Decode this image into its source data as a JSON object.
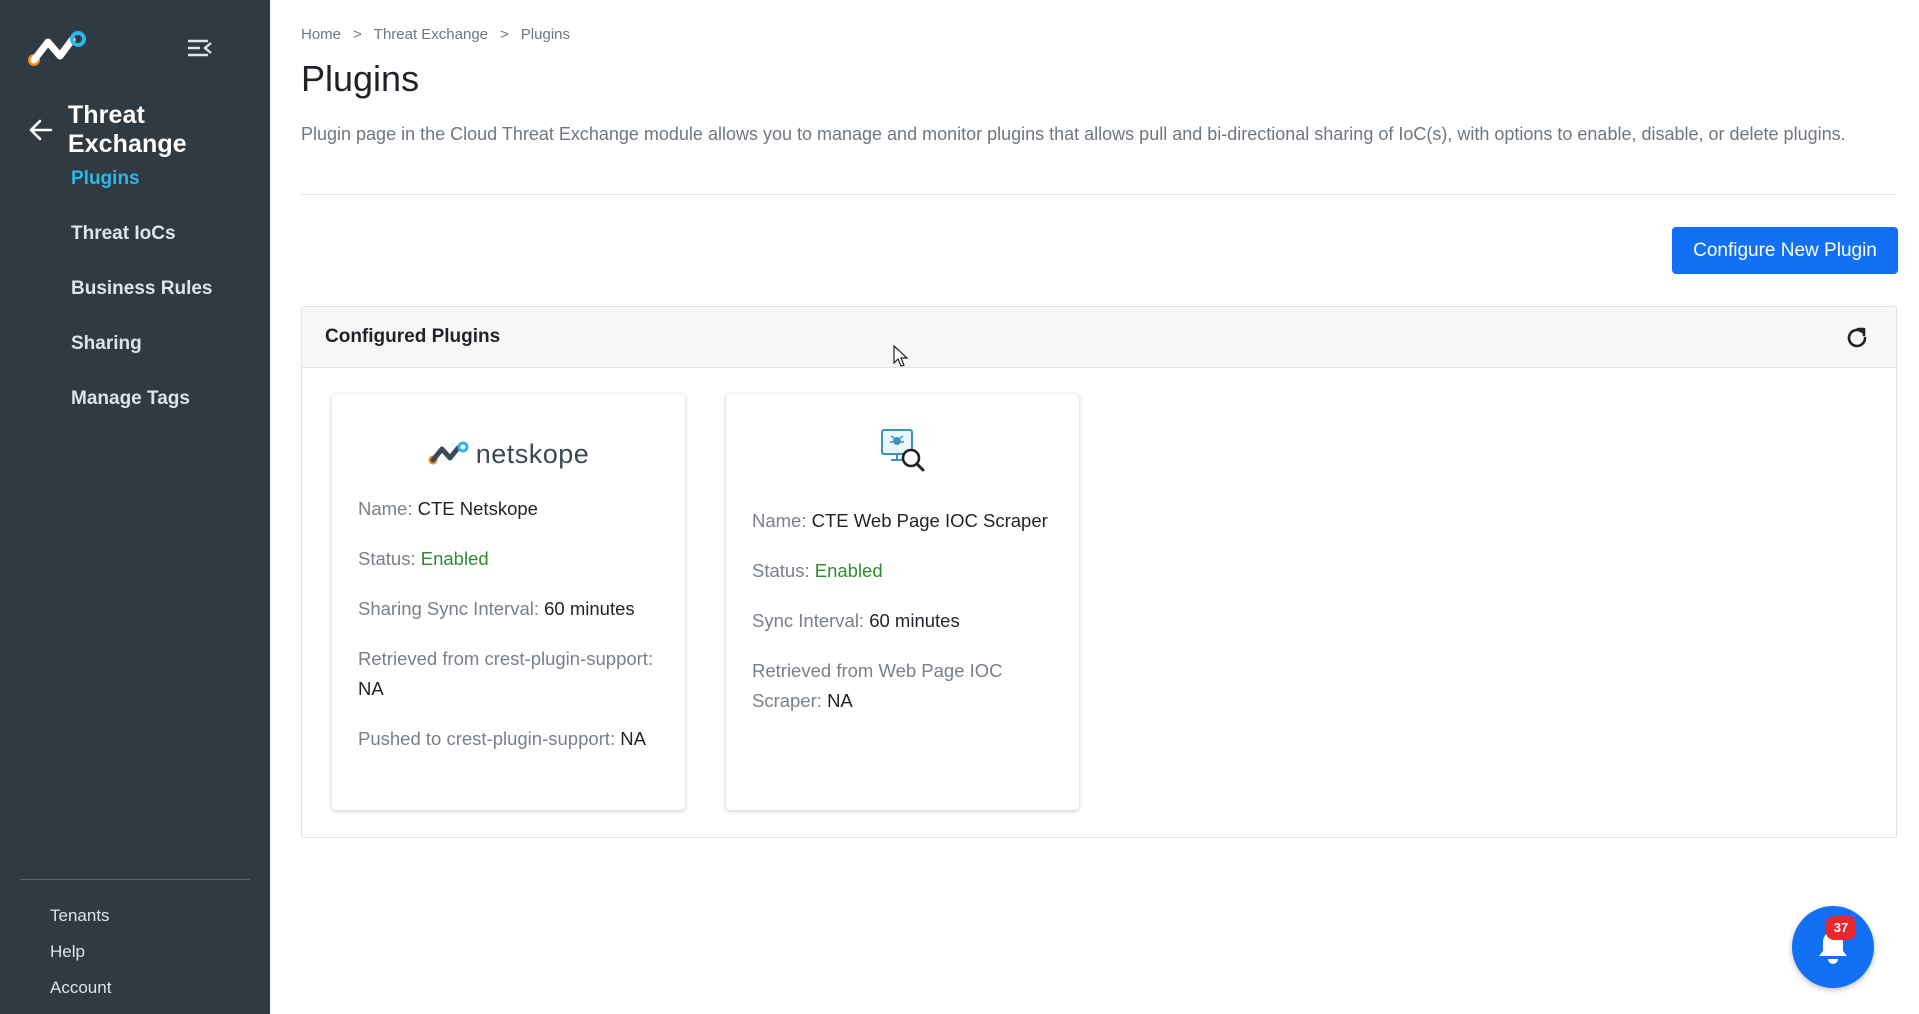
{
  "sidebar": {
    "section_title": "Threat Exchange",
    "items": [
      {
        "label": "Plugins",
        "active": true
      },
      {
        "label": "Threat IoCs"
      },
      {
        "label": "Business Rules"
      },
      {
        "label": "Sharing"
      },
      {
        "label": "Manage Tags"
      }
    ],
    "bottom_items": [
      {
        "label": "Tenants"
      },
      {
        "label": "Help"
      },
      {
        "label": "Account"
      }
    ]
  },
  "breadcrumb": {
    "items": [
      "Home",
      "Threat Exchange",
      "Plugins"
    ],
    "separator": ">"
  },
  "page": {
    "title": "Plugins",
    "description": "Plugin page in the Cloud Threat Exchange module allows you to manage and monitor plugins that allows pull and bi-directional sharing of IoC(s), with options to enable, disable, or delete plugins."
  },
  "toolbar": {
    "configure_label": "Configure New Plugin"
  },
  "panel": {
    "title": "Configured Plugins"
  },
  "plugins": [
    {
      "logo_text": "netskope",
      "name_label": "Name:",
      "name": "CTE Netskope",
      "status_label": "Status:",
      "status": "Enabled",
      "interval_label": "Sharing Sync Interval:",
      "interval": "60 minutes",
      "retrieved_label": "Retrieved from crest-plugin-support:",
      "retrieved": "NA",
      "pushed_label": "Pushed to crest-plugin-support:",
      "pushed": "NA"
    },
    {
      "name_label": "Name:",
      "name": "CTE Web Page IOC Scraper",
      "status_label": "Status:",
      "status": "Enabled",
      "interval_label": "Sync Interval:",
      "interval": "60 minutes",
      "retrieved_label": "Retrieved from Web Page IOC Scraper:",
      "retrieved": "NA"
    }
  ],
  "notifications": {
    "count": "37"
  },
  "colors": {
    "sidebar_bg": "#2f3a42",
    "active_nav": "#2db7e8",
    "primary_button": "#1270f5",
    "enabled_status": "#2e8b2e",
    "badge": "#e8282b"
  }
}
